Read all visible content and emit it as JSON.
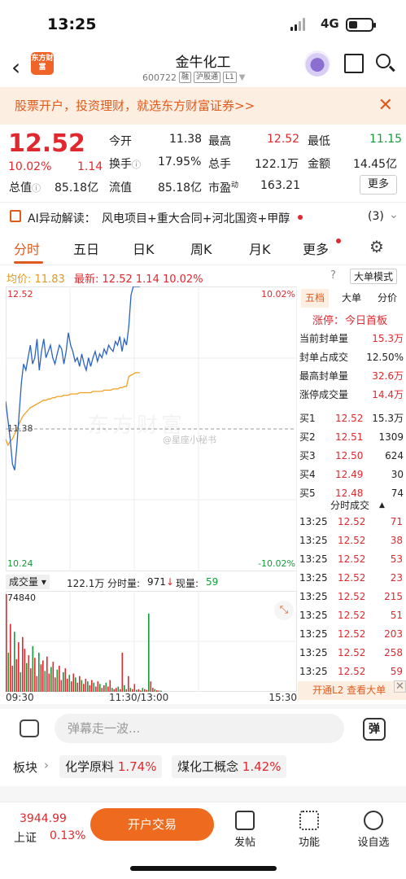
{
  "status": {
    "time": "13:25",
    "network": "4G"
  },
  "nav": {
    "title": "金牛化工",
    "code": "600722",
    "tags": [
      "融",
      "沪股通",
      "L1"
    ],
    "logo_text": "东方财富"
  },
  "banner": {
    "text": "股票开户，投资理财，就选东方财富证券>>",
    "close": "✕"
  },
  "quote": {
    "price": "12.52",
    "change_pct": "10.02%",
    "change": "1.14",
    "open_label": "今开",
    "open": "11.38",
    "high_label": "最高",
    "high": "12.52",
    "low_label": "最低",
    "low": "11.15",
    "turnover_label": "换手",
    "turnover": "17.95%",
    "volume_label": "总手",
    "volume": "122.1万",
    "amount_label": "金额",
    "amount": "14.45亿",
    "mktcap_label": "总值",
    "mktcap": "85.18亿",
    "float_label": "流值",
    "float": "85.18亿",
    "pe_label": "市盈",
    "pe_sup": "动",
    "pe": "163.21",
    "more": "更多"
  },
  "ai": {
    "label": "AI异动解读：",
    "text": "风电项目+重大合同+河北国资+甲醇",
    "count": "(3)"
  },
  "tabs": [
    "分时",
    "五日",
    "日K",
    "周K",
    "月K",
    "更多"
  ],
  "avgline": {
    "avg_label": "均价:",
    "avg": "11.83",
    "latest_label": "最新:",
    "latest": "12.52",
    "chg": "1.14",
    "pct": "10.02%",
    "mode": "大单模式"
  },
  "chart": {
    "y_top": "12.52",
    "y_bottom": "10.24",
    "pct_top": "10.02%",
    "pct_bottom": "-10.02%",
    "prev_close": "11.38",
    "watermark": "东方财富",
    "weibo": "@星座小秘书"
  },
  "chart_data": {
    "type": "line",
    "ylim": [
      10.24,
      12.52
    ],
    "prev_close": 11.38,
    "series": [
      {
        "name": "price",
        "values": [
          11.6,
          11.45,
          11.3,
          11.1,
          11.05,
          11.25,
          11.5,
          11.75,
          11.9,
          11.85,
          11.95,
          12.05,
          11.9,
          11.95,
          12.1,
          11.85,
          12.0,
          12.1,
          11.95,
          12.0,
          12.05,
          11.95,
          11.9,
          11.98,
          12.05,
          12.02,
          11.9,
          12.0,
          12.15,
          12.05,
          12.0,
          11.92,
          11.95,
          11.88,
          11.98,
          11.9,
          11.85,
          11.95,
          11.88,
          11.95,
          12.0,
          11.92,
          11.98,
          11.95,
          12.02,
          11.98,
          12.05,
          12.02,
          12.0,
          12.08,
          12.05,
          12.12,
          12.0,
          12.1,
          12.05,
          12.2,
          12.45,
          12.52,
          12.52,
          12.52,
          12.52
        ]
      },
      {
        "name": "avg",
        "values": [
          11.3,
          11.25,
          11.28,
          11.3,
          11.34,
          11.38,
          11.42,
          11.46,
          11.49,
          11.51,
          11.53,
          11.55,
          11.56,
          11.57,
          11.58,
          11.59,
          11.6,
          11.61,
          11.61,
          11.62,
          11.62,
          11.63,
          11.63,
          11.64,
          11.64,
          11.64,
          11.65,
          11.65,
          11.65,
          11.66,
          11.66,
          11.66,
          11.66,
          11.67,
          11.67,
          11.67,
          11.67,
          11.67,
          11.67,
          11.68,
          11.68,
          11.68,
          11.68,
          11.68,
          11.69,
          11.69,
          11.69,
          11.69,
          11.7,
          11.7,
          11.7,
          11.71,
          11.71,
          11.72,
          11.72,
          11.8,
          11.81,
          11.82,
          11.83,
          11.83,
          11.83
        ]
      }
    ]
  },
  "volume": {
    "label": "成交量",
    "total": "122.1万",
    "fen_label": "分时量:",
    "fen": "971",
    "xian_label": "现量:",
    "xian": "59",
    "max": "74840"
  },
  "volume_data": [
    74840,
    30000,
    52000,
    20000,
    46000,
    25000,
    38000,
    15000,
    42000,
    33000,
    22000,
    28000,
    18000,
    35000,
    26000,
    12000,
    30000,
    21000,
    24000,
    16000,
    27000,
    14000,
    19000,
    23000,
    11000,
    17000,
    20000,
    9000,
    15000,
    18000,
    10000,
    13000,
    8000,
    14000,
    11000,
    7000,
    12000,
    9000,
    6000,
    10000,
    8000,
    5000,
    9000,
    7000,
    4000,
    8000,
    6000,
    3000,
    5000,
    7000,
    4000,
    9000,
    3000,
    2000,
    3000,
    4000,
    2000,
    30000,
    5000,
    2000,
    12000,
    3000,
    2000,
    6000,
    1500,
    2000,
    1000,
    3000,
    2000,
    1500,
    60000,
    8000,
    3000,
    2000,
    1200,
    1000,
    900
  ],
  "xaxis": {
    "start": "09:30",
    "mid": "11:30/13:00",
    "end": "15:30"
  },
  "rpanel": {
    "tabs": [
      "五档",
      "大单",
      "分价"
    ],
    "limit_label": "涨停：",
    "limit_text": "今日首板",
    "stats": [
      {
        "k": "当前封单量",
        "v": "15.3万"
      },
      {
        "k": "封单占成交",
        "v": "12.50%"
      },
      {
        "k": "最高封单量",
        "v": "32.6万"
      },
      {
        "k": "涨停成交量",
        "v": "14.4万"
      }
    ],
    "bids": [
      {
        "k": "买1",
        "p": "12.52",
        "v": "15.3万"
      },
      {
        "k": "买2",
        "p": "12.51",
        "v": "1309"
      },
      {
        "k": "买3",
        "p": "12.50",
        "v": "624"
      },
      {
        "k": "买4",
        "p": "12.49",
        "v": "30"
      },
      {
        "k": "买5",
        "p": "12.48",
        "v": "74"
      }
    ],
    "ticks_title": "分时成交",
    "ticks": [
      {
        "t": "13:25",
        "p": "12.52",
        "v": "71"
      },
      {
        "t": "13:25",
        "p": "12.52",
        "v": "38"
      },
      {
        "t": "13:25",
        "p": "12.52",
        "v": "53"
      },
      {
        "t": "13:25",
        "p": "12.52",
        "v": "23"
      },
      {
        "t": "13:25",
        "p": "12.52",
        "v": "215"
      },
      {
        "t": "13:25",
        "p": "12.52",
        "v": "51"
      },
      {
        "t": "13:25",
        "p": "12.52",
        "v": "203"
      },
      {
        "t": "13:25",
        "p": "12.52",
        "v": "258"
      },
      {
        "t": "13:25",
        "p": "12.52",
        "v": "59"
      }
    ],
    "l2": "开通L2 查看大单"
  },
  "danmu": {
    "placeholder": "弹幕走一波..."
  },
  "plates": {
    "label": "板块",
    "items": [
      {
        "name": "化学原料",
        "pct": "1.74%"
      },
      {
        "name": "煤化工概念",
        "pct": "1.42%"
      }
    ]
  },
  "bottom": {
    "index_value": "3944.99",
    "index_name": "上证",
    "index_pct": "0.13%",
    "trade": "开户交易",
    "post": "发帖",
    "func": "功能",
    "settings": "设自选"
  }
}
